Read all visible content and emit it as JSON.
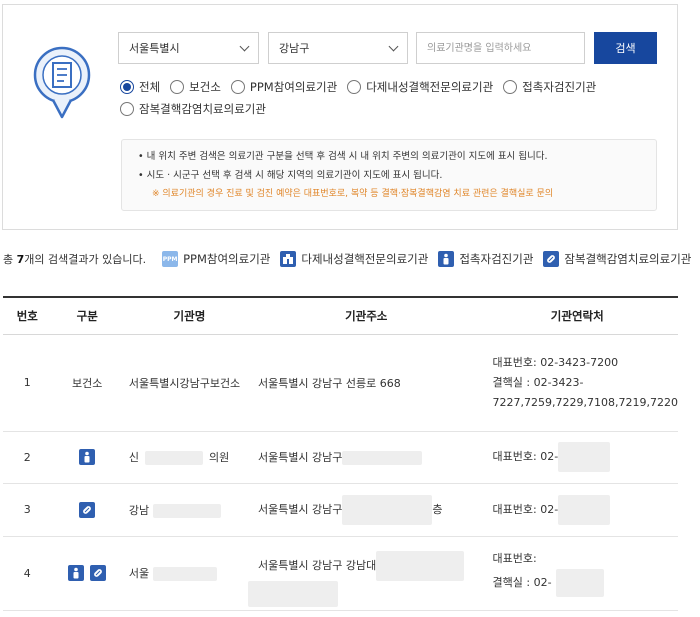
{
  "search": {
    "region": "서울특별시",
    "district": "강남구",
    "placeholder": "의료기관명을 입력하세요",
    "button_label": "검색"
  },
  "filters": [
    {
      "label": "전체",
      "selected": true
    },
    {
      "label": "보건소",
      "selected": false
    },
    {
      "label": "PPM참여의료기관",
      "selected": false
    },
    {
      "label": "다제내성결핵전문의료기관",
      "selected": false
    },
    {
      "label": "접촉자검진기관",
      "selected": false
    },
    {
      "label": "잠복결핵감염치료의료기관",
      "selected": false
    }
  ],
  "notice": {
    "line1": "내 위치 주변 검색은 의료기관 구분을 선택 후 검색 시 내 위치 주변의 의료기관이 지도에 표시 됩니다.",
    "line2": "시도 · 시군구 선택 후 검색 시 해당 지역의 의료기관이 지도에 표시 됩니다.",
    "warning": "※ 의료기관의 경우 진료 및 검진 예약은 대표번호로, 복약 등 결핵·잠복결핵감염 치료 관련은 결핵실로 문의"
  },
  "result": {
    "prefix": "총 ",
    "count": "7",
    "suffix": "개의 검색결과가 있습니다."
  },
  "legend": [
    {
      "label": "PPM참여의료기관",
      "icon": "ppm-icon",
      "badge": "PPM"
    },
    {
      "label": "다제내성결핵전문의료기관",
      "icon": "hospital-icon"
    },
    {
      "label": "접촉자검진기관",
      "icon": "person-icon"
    },
    {
      "label": "잠복결핵감염치료의료기관",
      "icon": "pill-icon"
    }
  ],
  "table": {
    "headers": [
      "번호",
      "구분",
      "기관명",
      "기관주소",
      "기관연락처"
    ],
    "rows": [
      {
        "no": "1",
        "category": "보건소",
        "name": "서울특별시강남구보건소",
        "address": "서울특별시 강남구 선릉로 668",
        "tel1": "대표번호: 02-3423-7200",
        "tel2": "결핵실 : 02-3423-",
        "tel3": "7227,7259,7229,7108,7219,7220"
      },
      {
        "no": "2",
        "name_start": "신",
        "name_end": "의원",
        "address": "서울특별시 강남구",
        "tel1": "대표번호: 02-"
      },
      {
        "no": "3",
        "name_start": "강남",
        "address": "서울특별시 강남구",
        "address_end": "층",
        "tel1": "대표번호: 02-"
      },
      {
        "no": "4",
        "name_start": "서울",
        "address": "서울특별시 강남구 강남대",
        "tel1": "대표번호:",
        "tel2": "결핵실 : 02-"
      }
    ]
  },
  "colors": {
    "primary": "#17479e",
    "icon_blue": "#2f5fb0",
    "ppm_light": "#8bb7ea",
    "warning": "#e0862a"
  }
}
